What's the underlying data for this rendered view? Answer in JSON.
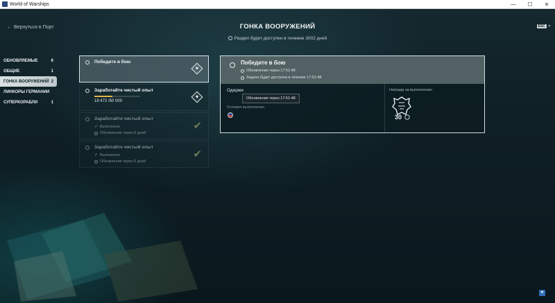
{
  "window": {
    "title": "World of Warships",
    "minimize": "—",
    "maximize": "☐",
    "close": "✕"
  },
  "nav": {
    "back_label": "Вернуться в Порт",
    "esc_key": "ESC"
  },
  "header": {
    "title": "ГОНКА ВООРУЖЕНИЙ",
    "availability": "Раздел будет доступен в течение 3002 дней"
  },
  "sidebar": {
    "items": [
      {
        "label": "ОБНОВЛЯЕМЫЕ",
        "count": "6"
      },
      {
        "label": "ОБЩИЕ",
        "count": "1"
      },
      {
        "label": "ГОНКА ВООРУЖЕНИЙ",
        "count": "2"
      },
      {
        "label": "ЛИНКОРЫ ГЕРМАНИИ",
        "count": ""
      },
      {
        "label": "СУПЕРКОРАБЛИ",
        "count": "1"
      }
    ]
  },
  "quests": [
    {
      "title": "Победите в бою"
    },
    {
      "title": "Заработайте чистый опыт",
      "progress_text": "19 472 /50 000",
      "progress_fraction": 0.39
    },
    {
      "title": "Заработайте чистый опыт",
      "status": "Выполнено",
      "refresh": "Обновление через 6 дней"
    },
    {
      "title": "Заработайте чистый опыт",
      "status": "Выполнено",
      "refresh": "Обновление через 6 дней"
    }
  ],
  "detail": {
    "title": "Победите в бою",
    "refresh": "Обновление через 17:51:48",
    "available": "Задача будет доступна в течение 17:51:48",
    "task_text": "Одержи",
    "conditions_label": "Условия выполнения",
    "reward_label": "Награда за выполнение:",
    "reward_amount": "30"
  },
  "tooltip": {
    "text": "Обновление через 17:51:48"
  },
  "colors": {
    "progress": "#e0b84a",
    "accent_check": "#6e7a58"
  }
}
